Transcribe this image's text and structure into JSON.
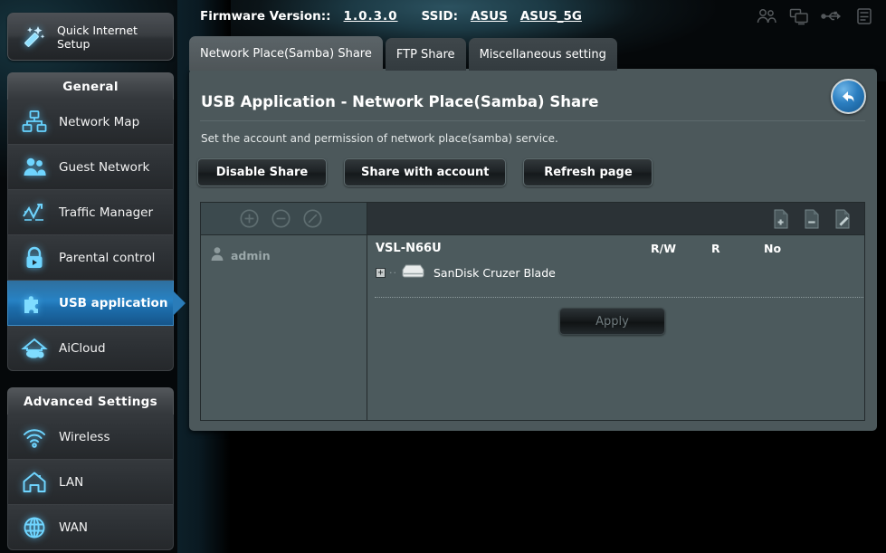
{
  "header": {
    "firmware_label": "Firmware Version::",
    "firmware_value": "1.0.3.0",
    "ssid_label": "SSID:",
    "ssid_1": "ASUS",
    "ssid_2": "ASUS_5G",
    "icons": [
      "guests-icon",
      "devices-icon",
      "usb-icon",
      "printer-icon"
    ]
  },
  "quick_setup": {
    "label": "Quick Internet Setup",
    "icon": "magic-wand-icon"
  },
  "sidebar": {
    "general": {
      "title": "General",
      "items": [
        {
          "label": "Network Map",
          "icon": "network-map-icon",
          "active": false
        },
        {
          "label": "Guest Network",
          "icon": "guest-network-icon",
          "active": false
        },
        {
          "label": "Traffic Manager",
          "icon": "traffic-manager-icon",
          "active": false
        },
        {
          "label": "Parental control",
          "icon": "parental-control-icon",
          "active": false
        },
        {
          "label": "USB application",
          "icon": "usb-application-icon",
          "active": true
        },
        {
          "label": "AiCloud",
          "icon": "aicloud-icon",
          "active": false
        }
      ]
    },
    "advanced": {
      "title": "Advanced Settings",
      "items": [
        {
          "label": "Wireless",
          "icon": "wireless-icon"
        },
        {
          "label": "LAN",
          "icon": "lan-icon"
        },
        {
          "label": "WAN",
          "icon": "wan-icon"
        }
      ]
    }
  },
  "tabs": [
    {
      "label": "Network Place(Samba) Share",
      "active": true
    },
    {
      "label": "FTP Share",
      "active": false
    },
    {
      "label": "Miscellaneous setting",
      "active": false
    }
  ],
  "main": {
    "title": "USB Application - Network Place(Samba) Share",
    "description": "Set the account and permission of network place(samba) service.",
    "back_icon": "back-arrow-icon",
    "buttons": [
      {
        "label": "Disable Share"
      },
      {
        "label": "Share with account"
      },
      {
        "label": "Refresh page"
      }
    ],
    "user_toolbar": [
      {
        "icon": "add-user-icon"
      },
      {
        "icon": "remove-user-icon"
      },
      {
        "icon": "edit-user-icon"
      }
    ],
    "folder_toolbar": [
      {
        "icon": "add-folder-icon"
      },
      {
        "icon": "remove-folder-icon"
      },
      {
        "icon": "rename-folder-icon"
      }
    ],
    "users": [
      {
        "name": "admin",
        "icon": "user-avatar-icon"
      }
    ],
    "device_name": "VSL-N66U",
    "permissions": [
      "R/W",
      "R",
      "No"
    ],
    "disk": {
      "name": "SanDisk Cruzer Blade",
      "expander": "+",
      "icon": "hard-disk-icon"
    },
    "apply_label": "Apply"
  },
  "colors": {
    "accent": "#2782c4",
    "panel": "#4c585b",
    "panel_body": "#4c5a5d",
    "toolbar_dark": "#2b3236",
    "toolbar_light": "#3c4a4e"
  }
}
